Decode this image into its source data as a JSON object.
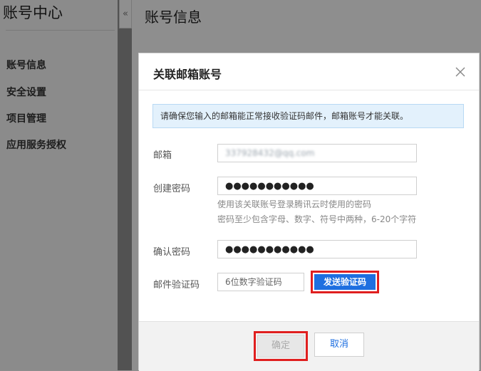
{
  "sidebar": {
    "title": "账号中心",
    "collapse_glyph": "«",
    "items": [
      {
        "label": "账号信息"
      },
      {
        "label": "安全设置"
      },
      {
        "label": "项目管理"
      },
      {
        "label": "应用服务授权"
      }
    ]
  },
  "main": {
    "title": "账号信息"
  },
  "modal": {
    "title": "关联邮箱账号",
    "close_icon": "close-icon",
    "notice": "请确保您输入的邮箱能正常接收验证码邮件，邮箱账号才能关联。",
    "email": {
      "label": "邮箱",
      "value": "337928432@qq.com"
    },
    "password": {
      "label": "创建密码",
      "value": "●●●●●●●●●●●"
    },
    "hint_line1": "使用该关联账号登录腾讯云时使用的密码",
    "hint_line2": "密码至少包含字母、数字、符号中两种，6-20个字符",
    "confirm_password": {
      "label": "确认密码",
      "value": "●●●●●●●●●●●"
    },
    "code": {
      "label": "邮件验证码",
      "placeholder": "6位数字验证码"
    },
    "send_code_button": "发送验证码",
    "confirm_button": "确定",
    "cancel_button": "取消"
  },
  "colors": {
    "primary": "#1e6fe0",
    "highlight_border": "#e01f1f",
    "notice_bg": "#e3f1fc"
  }
}
